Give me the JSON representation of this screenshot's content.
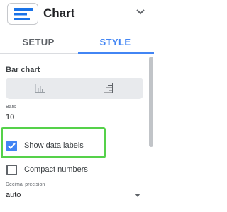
{
  "header": {
    "title": "Chart",
    "chart_icon": "chart-type-icon",
    "menu_icon": "chevron-down-icon"
  },
  "tabs": [
    {
      "label": "SETUP",
      "active": false
    },
    {
      "label": "STYLE",
      "active": true
    }
  ],
  "style_panel": {
    "section_title": "Bar chart",
    "orientation": {
      "options": [
        {
          "icon": "vertical-bars-icon",
          "selected": false
        },
        {
          "icon": "horizontal-bars-icon",
          "selected": false
        }
      ]
    },
    "bars": {
      "label": "Bars",
      "value": "10"
    },
    "show_data_labels": {
      "label": "Show data labels",
      "checked": true
    },
    "compact_numbers": {
      "label": "Compact numbers",
      "checked": false
    },
    "decimal_precision": {
      "label": "Decimal precision",
      "value": "auto"
    }
  },
  "colors": {
    "accent": "#4285f4",
    "highlight": "#55d14a",
    "button_group_bg": "#e8eaed"
  }
}
